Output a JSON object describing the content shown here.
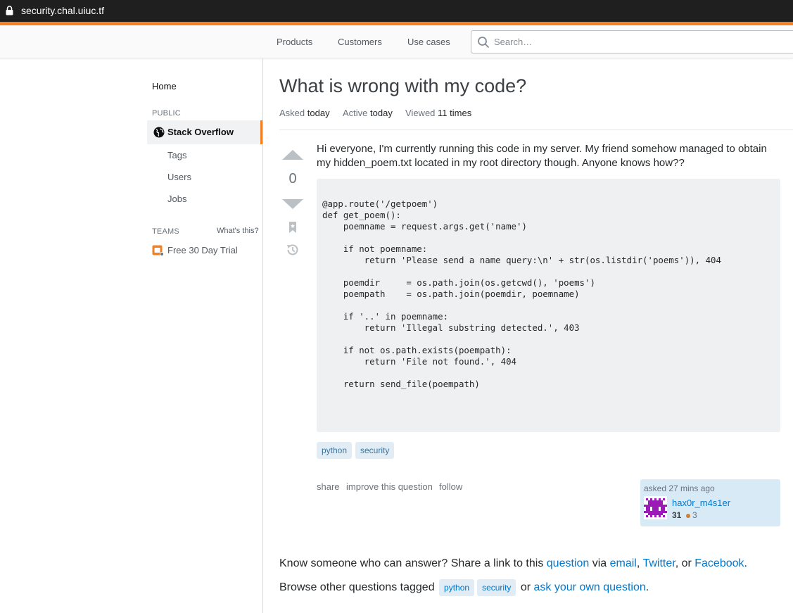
{
  "browser": {
    "url": "security.chal.uiuc.tf"
  },
  "header": {
    "nav": [
      "Products",
      "Customers",
      "Use cases"
    ],
    "search_placeholder": "Search…"
  },
  "sidebar": {
    "home": "Home",
    "public_label": "PUBLIC",
    "active_item": "Stack Overflow",
    "items": [
      "Tags",
      "Users",
      "Jobs"
    ],
    "teams_label": "TEAMS",
    "whats_this": "What's this?",
    "trial": "Free 30 Day Trial",
    "accent_color": "#f48024"
  },
  "question": {
    "title": "What is wrong with my code?",
    "asked_label": "Asked",
    "asked_value": "today",
    "active_label": "Active",
    "active_value": "today",
    "viewed_label": "Viewed",
    "viewed_value": "11 times",
    "votes": "0",
    "body": "Hi everyone, I'm currently running this code in my server. My friend somehow managed to obtain my hidden_poem.txt located in my root directory though. Anyone knows how??",
    "code": "@app.route('/getpoem')\ndef get_poem():\n    poemname = request.args.get('name')\n\n    if not poemname:\n        return 'Please send a name query:\\n' + str(os.listdir('poems')), 404\n\n    poemdir     = os.path.join(os.getcwd(), 'poems')\n    poempath    = os.path.join(poemdir, poemname)\n\n    if '..' in poemname:\n        return 'Illegal substring detected.', 403\n\n    if not os.path.exists(poempath):\n        return 'File not found.', 404\n\n    return send_file(poempath)",
    "tags": [
      "python",
      "security"
    ],
    "menu": {
      "share": "share",
      "improve": "improve this question",
      "follow": "follow"
    },
    "owner": {
      "asked_time": "asked 27 mins ago",
      "name": "hax0r_m4s1er",
      "reputation": "31",
      "bronze_badges": "3",
      "avatar_color": "#9b1ab8"
    }
  },
  "footer": {
    "line1": {
      "prefix": "Know someone who can answer? Share a link to this ",
      "question_link": "question",
      "via": " via ",
      "email": "email",
      "comma1": ", ",
      "twitter": "Twitter",
      "or": ", or ",
      "facebook": "Facebook",
      "period": "."
    },
    "line2": {
      "prefix": "Browse other questions tagged ",
      "tags": [
        "python",
        "security"
      ],
      "or": " or ",
      "ask_link": "ask your own question",
      "period": "."
    }
  }
}
